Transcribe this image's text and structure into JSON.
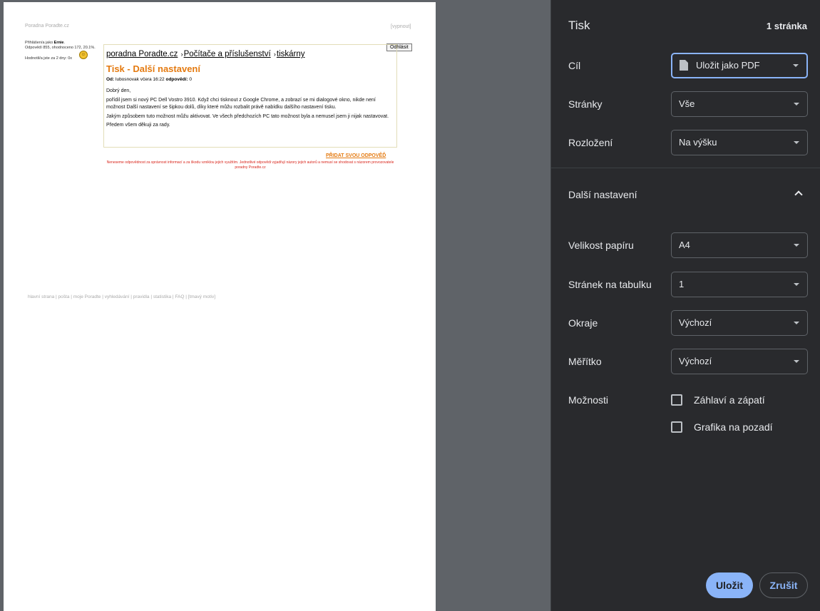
{
  "preview": {
    "site_name": "Poradna Poradte.cz",
    "disable_link": "[vypnout]",
    "login_prefix": "Přihlášen/a jako ",
    "login_user": "Ernie",
    "login_stats": "Odpovědí 855, ohodnoceno 172, 20.1%.",
    "rating_text": "Hodnotil/a jste za 2 dny: 0x",
    "logout_button": "Odhlásit",
    "breadcrumb": {
      "item1": "poradna Poradte.cz",
      "item2": "Počítače a příslušenství",
      "item3": "tiskárny",
      "separator": "›"
    },
    "post": {
      "title": "Tisk - Další nastavení",
      "from_label": "Od:",
      "from_value": " lubosnovak včera 16:22 ",
      "answers_label": "odpovědí:",
      "answers_value": " 0",
      "paragraphs": [
        "Dobrý den,",
        "pořídil jsem si nový PC Dell Vostro 3910. Když chci tisknout z Google Chrome, a zobrazí se mi dialogové okno, nikde není možnost Další nastavení se šipkou dolů, díky které můžu rozbalit právě nabídku dalšího nastavení tisku.",
        "Jakým způsobem tuto možnost můžu aktivovat. Ve všech předchozích PC tato možnost byla a nemusel jsem ji nijak nastavovat.",
        "Předem všem děkuji za rady."
      ]
    },
    "add_answer": "PŘIDAT SVOU ODPOVĚĎ",
    "disclaimer": "Neneseme odpovědnost za správnost informací a za škodu vzniklou jejich využitím. Jednotlivé odpovědi vyjadřují názory jejich autorů a nemusí se shodovat s názorem provozovatele poradny Poradte.cz",
    "footer_links": [
      "hlavní strana",
      "pošta",
      "moje Poradte",
      "vyhledávání",
      "pravidla",
      "statistika",
      "FAQ",
      "[tmavý motiv]"
    ],
    "footer_separator": " | "
  },
  "panel": {
    "title": "Tisk",
    "page_count": "1 stránka",
    "destination": {
      "label": "Cíl",
      "value": "Uložit jako PDF",
      "icon": "pdf-file-icon"
    },
    "pages": {
      "label": "Stránky",
      "value": "Vše"
    },
    "layout": {
      "label": "Rozložení",
      "value": "Na výšku"
    },
    "more_settings": {
      "label": "Další nastavení",
      "icon": "chevron-up-icon"
    },
    "paper_size": {
      "label": "Velikost papíru",
      "value": "A4"
    },
    "pages_per_sheet": {
      "label": "Stránek na tabulku",
      "value": "1"
    },
    "margins": {
      "label": "Okraje",
      "value": "Výchozí"
    },
    "scale": {
      "label": "Měřítko",
      "value": "Výchozí"
    },
    "options": {
      "label": "Možnosti",
      "header_footer": {
        "label": "Záhlaví a zápatí",
        "checked": false
      },
      "background_graphics": {
        "label": "Grafika na pozadí",
        "checked": false
      }
    },
    "save_button": "Uložit",
    "cancel_button": "Zrušit",
    "colors": {
      "accent": "#8ab4f8",
      "panel_bg": "#292a2d",
      "backdrop": "#5f6368",
      "title_orange": "#e47a10"
    }
  }
}
